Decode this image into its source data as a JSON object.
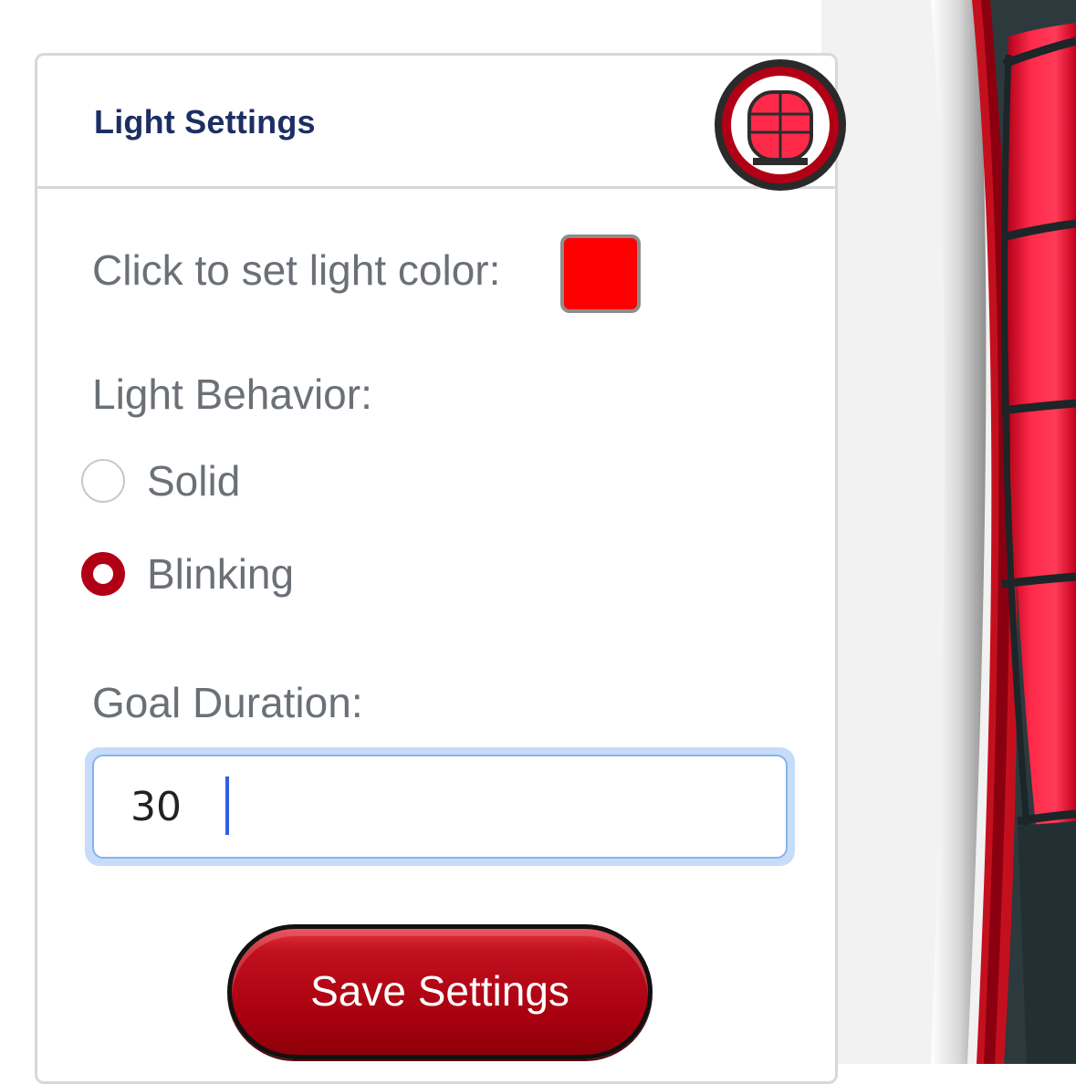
{
  "header": {
    "title": "Light Settings"
  },
  "color": {
    "label": "Click to set light color:",
    "value": "#ff0000"
  },
  "behavior": {
    "label": "Light Behavior:",
    "options": [
      {
        "label": "Solid",
        "selected": false
      },
      {
        "label": "Blinking",
        "selected": true
      }
    ]
  },
  "duration": {
    "label": "Goal Duration:",
    "value": "30"
  },
  "actions": {
    "save_label": "Save Settings"
  },
  "theme": {
    "accent": "#b10016",
    "title_color": "#1c2f64",
    "label_color": "#6b7077",
    "focus_ring": "#86b3ee"
  },
  "icons": {
    "header_badge": "goal-light-icon"
  }
}
